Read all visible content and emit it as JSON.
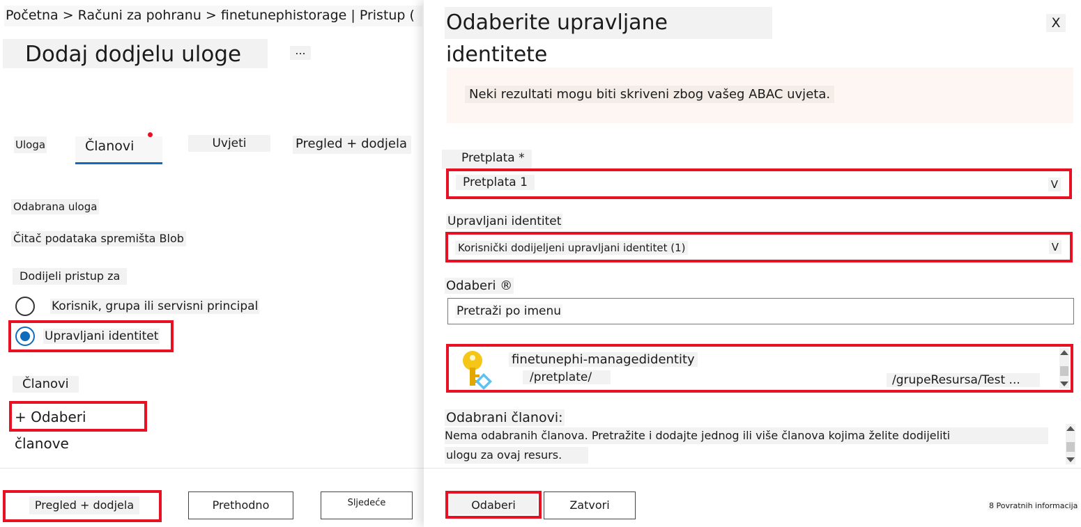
{
  "left": {
    "breadcrumb": "Početna > Računi za pohranu > finetunephistorage | Pristup (",
    "title": "Dodaj dodjelu uloge",
    "more": "...",
    "tabs": {
      "uloga": "Uloga",
      "clanovi": "Članovi",
      "uvjeti": "Uvjeti",
      "pregled": "Pregled + dodjela"
    },
    "selected_role_label": "Odabrana uloga",
    "selected_role_value": "Čitač podataka spremišta Blob",
    "assign_access_label": "Dodijeli pristup za",
    "radio_user": "Korisnik, grupa ili servisni principal",
    "radio_managed": "Upravljani identitet",
    "members_label": "Članovi",
    "select_members": "+ Odaberi članove",
    "footer": {
      "review": "Pregled + dodjela",
      "previous": "Prethodno",
      "next": "Sljedeće"
    }
  },
  "right": {
    "title": "Odaberite upravljane identitete",
    "close": "X",
    "warning": "Neki rezultati mogu biti skriveni zbog vašeg ABAC uvjeta.",
    "subscription_label": "Pretplata *",
    "subscription_value": "Pretplata 1",
    "managed_identity_label": "Upravljani identitet",
    "managed_identity_value": "Korisnički dodijeljeni upravljani identitet (1)",
    "chevron": "V",
    "select_label": "Odaberi ®",
    "search_placeholder": "Pretraži po imenu",
    "result": {
      "name": "finetunephi-managedidentity",
      "path1": "/pretplate/",
      "path2": "/grupeResursa/Test ..."
    },
    "selected_members_label": "Odabrani članovi:",
    "selected_members_line1": "Nema odabranih članova. Pretražite i dodajte jednog ili više članova kojima želite dodijeliti",
    "selected_members_line2": "ulogu za ovaj resurs.",
    "footer": {
      "select": "Odaberi",
      "close": "Zatvori",
      "feedback": "8 Povratnih informacija"
    }
  },
  "colors": {
    "accent": "#0f6cbd",
    "highlight_red": "#e81123",
    "warning_bg": "#fdf6f2"
  }
}
